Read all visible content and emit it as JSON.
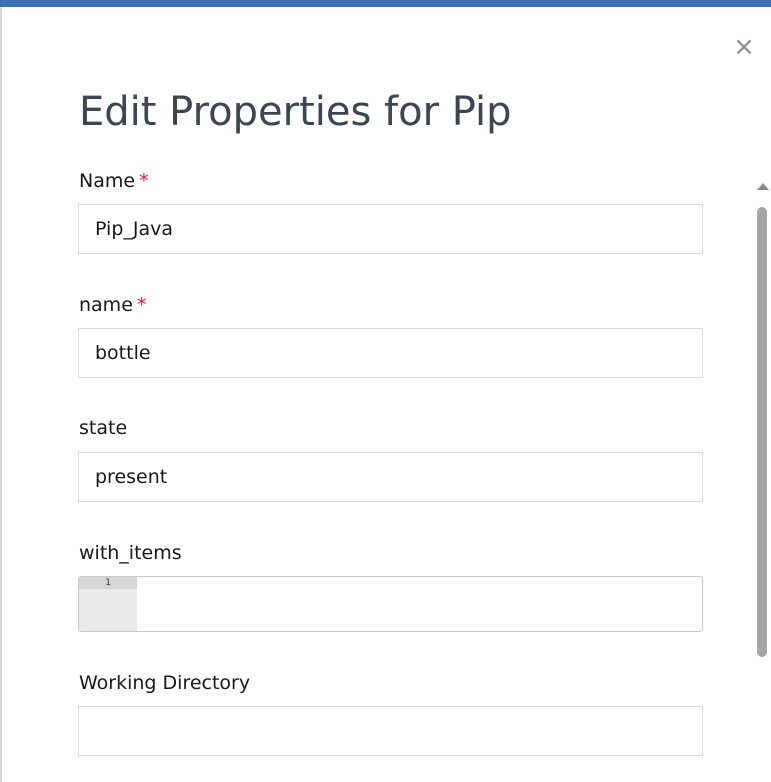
{
  "dialog": {
    "title": "Edit Properties for Pip",
    "close_glyph": "×",
    "close_icon": "close-icon"
  },
  "fields": {
    "name_display": {
      "label": "Name",
      "required_mark": "*",
      "value": "Pip_Java"
    },
    "name": {
      "label": "name",
      "required_mark": "*",
      "value": "bottle"
    },
    "state": {
      "label": "state",
      "value": "present"
    },
    "with_items": {
      "label": "with_items",
      "line_number": "1",
      "value": ""
    },
    "working_directory": {
      "label": "Working Directory",
      "value": ""
    }
  },
  "colors": {
    "header_bar": "#3d70b2",
    "title_text": "#3a4654",
    "required": "#e0182d",
    "input_border": "#dcdcdc"
  }
}
